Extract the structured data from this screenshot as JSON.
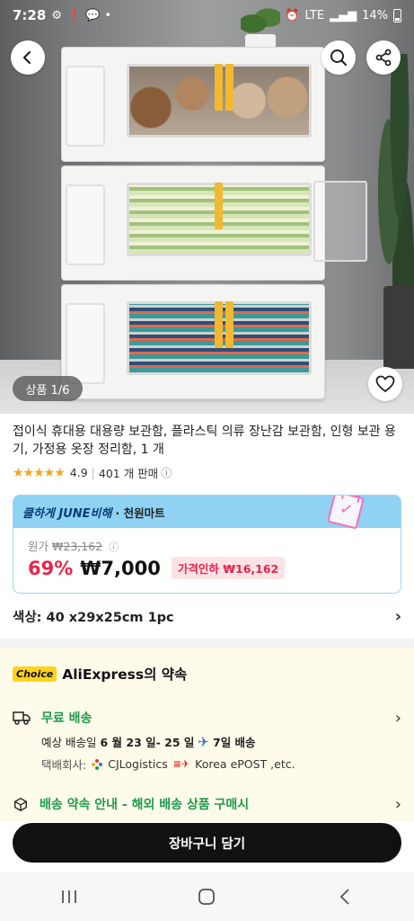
{
  "status_bar": {
    "time": "7:28",
    "battery": "14%",
    "network": "LTE"
  },
  "hero": {
    "image_counter": "상품 1/6"
  },
  "product": {
    "title": "접이식 휴대용 대용량 보관함, 플라스틱 의류 장난감 보관함, 인형 보관 용기, 가정용 옷장 정리함, 1 개",
    "rating": "4.9",
    "sold": "401 개 판매"
  },
  "price_card": {
    "promo": "쿨하게 JUNE비해",
    "store": "· 천원마트",
    "original_label": "원가",
    "original_price": "₩23,162",
    "discount": "69%",
    "price": "₩7,000",
    "cut_badge": "가격인하 ₩16,162",
    "accent": "#e8264a",
    "header_color": "#8fd2f3"
  },
  "option": {
    "label": "색상: 40 x29x25cm 1pc"
  },
  "promise": {
    "badge": "Choice",
    "title": "AliExpress의 약속",
    "shipping_title": "무료 배송",
    "eta_prefix": "예상 배송일",
    "eta_range": "6 월 23 일- 25 일",
    "eta_days": "7일 배송",
    "carrier_label": "택배회사:",
    "carrier_1": "CJLogistics",
    "carrier_2": "Korea ePOST ,etc.",
    "notice": "배송 약속 안내 - 해외 배송 상품 구매시",
    "green": "#1f9a4d"
  },
  "cart": {
    "label": "장바구니 담기"
  },
  "icons": {
    "back": "back-arrow-icon",
    "search": "search-icon",
    "share": "share-icon",
    "favorite": "heart-icon",
    "truck": "truck-icon",
    "box": "package-icon"
  }
}
